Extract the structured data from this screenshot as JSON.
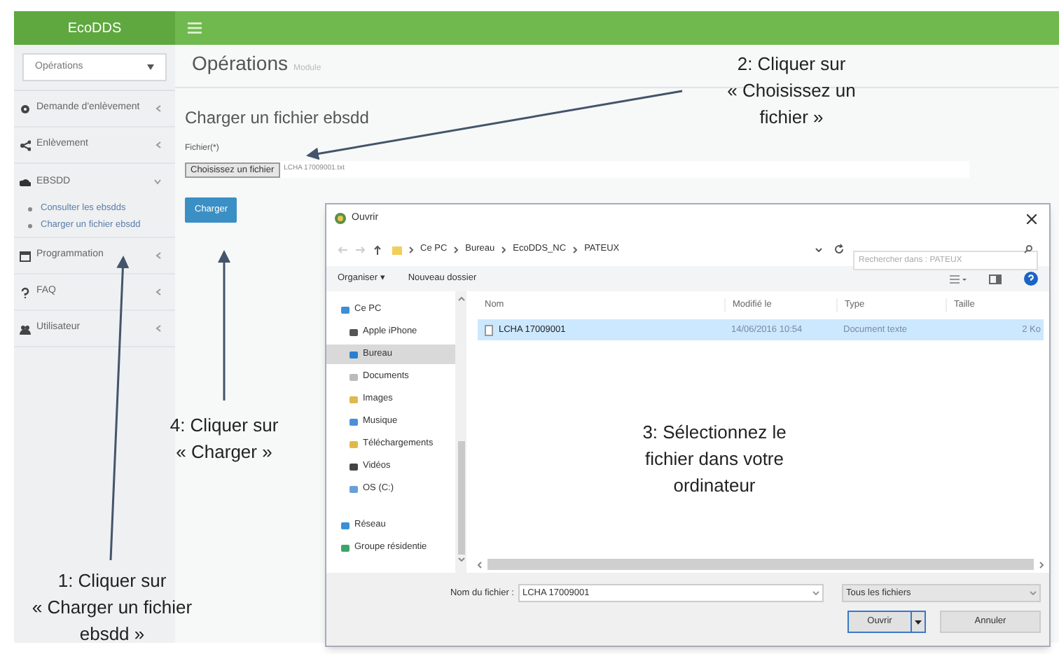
{
  "app": {
    "brand": "EcoDDS"
  },
  "sidebar": {
    "select": "Opérations",
    "items": [
      {
        "label": "Demande d'enlèvement",
        "kind": "gear",
        "expanded": false
      },
      {
        "label": "Enlèvement",
        "kind": "share",
        "expanded": false
      },
      {
        "label": "EBSDD",
        "kind": "cloud",
        "expanded": true,
        "children": [
          {
            "label": "Consulter les ebsdds"
          },
          {
            "label": "Charger un fichier ebsdd"
          }
        ]
      },
      {
        "label": "Programmation",
        "kind": "calendar",
        "expanded": false
      },
      {
        "label": "FAQ",
        "kind": "question",
        "expanded": false
      },
      {
        "label": "Utilisateur",
        "kind": "users",
        "expanded": false
      }
    ]
  },
  "page": {
    "title": "Opérations",
    "subtitle": "Module",
    "section": "Charger un fichier ebsdd",
    "field_label": "Fichier(*)",
    "file_button": "Choisissez un fichier",
    "file_name": "LCHA 17009001.txt",
    "submit": "Charger"
  },
  "dialog": {
    "title": "Ouvrir",
    "breadcrumb": [
      "Ce PC",
      "Bureau",
      "EcoDDS_NC",
      "PATEUX"
    ],
    "search": {
      "placeholder": "Rechercher dans : PATEUX"
    },
    "toolbar": [
      "Organiser ▾",
      "Nouveau dossier"
    ],
    "nav": [
      {
        "label": "Ce PC",
        "kind": "pc",
        "selected": false,
        "children": [
          {
            "label": "Apple iPhone",
            "kind": "phone",
            "selected": false
          },
          {
            "label": "Bureau",
            "kind": "desktop",
            "selected": true
          },
          {
            "label": "Documents",
            "kind": "docs",
            "selected": false
          },
          {
            "label": "Images",
            "kind": "images",
            "selected": false
          },
          {
            "label": "Musique",
            "kind": "music",
            "selected": false
          },
          {
            "label": "Téléchargements",
            "kind": "download",
            "selected": false
          },
          {
            "label": "Vidéos",
            "kind": "video",
            "selected": false
          },
          {
            "label": "OS (C:)",
            "kind": "drive",
            "selected": false
          }
        ]
      },
      {
        "label": "Réseau",
        "kind": "network",
        "selected": false
      },
      {
        "label": "Groupe résidentie",
        "kind": "homegroup",
        "selected": false
      }
    ],
    "columns": [
      "Nom",
      "Modifié le",
      "Type",
      "Taille"
    ],
    "rows": [
      {
        "cells": [
          "LCHA 17009001",
          "14/06/2016 10:54",
          "Document texte",
          "2 Ko"
        ],
        "selected": true
      }
    ],
    "filename_label": "Nom du fichier :",
    "filename": "LCHA 17009001",
    "filter": "Tous les fichiers",
    "buttons": [
      "Ouvrir",
      "Annuler"
    ]
  },
  "annotations": [
    {
      "text": "2: Cliquer sur\n« Choisissez un\nfichier »"
    },
    {
      "text": "4: Cliquer sur\n« Charger »"
    },
    {
      "text": "3: Sélectionnez le\nfichier dans votre\nordinateur"
    },
    {
      "text": "1: Cliquer sur\n« Charger un fichier\nebsdd »"
    }
  ]
}
